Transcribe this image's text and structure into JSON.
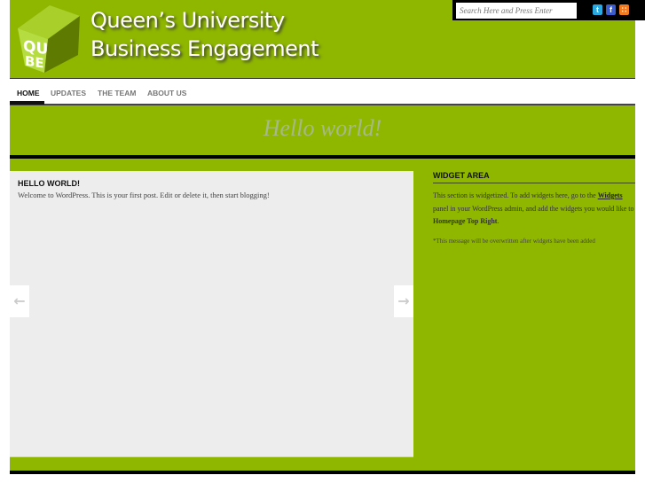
{
  "header": {
    "title_line1": "Queen’s University",
    "title_line2": "Business Engagement",
    "logo_text": "QUBE",
    "search_placeholder": "Search Here and Press Enter",
    "social": [
      {
        "name": "twitter",
        "glyph": "t",
        "color": "#2aa9e0"
      },
      {
        "name": "facebook",
        "glyph": "f",
        "color": "#3b5ccc"
      },
      {
        "name": "rss",
        "glyph": "∷",
        "color": "#f47a20"
      }
    ]
  },
  "nav": {
    "items": [
      {
        "label": "HOME",
        "active": true
      },
      {
        "label": "UPDATES"
      },
      {
        "label": "THE TEAM"
      },
      {
        "label": "ABOUT US"
      }
    ]
  },
  "featured": {
    "title": "Hello world!"
  },
  "post": {
    "title": "HELLO WORLD!",
    "body": "Welcome to WordPress. This is your first post. Edit or delete it, then start blogging!"
  },
  "slider": {
    "prev": "←",
    "next": "→"
  },
  "widget": {
    "title": "WIDGET AREA",
    "text1": "This section is widgetized. To add widgets here, go to the ",
    "link": "Widgets",
    "text2": " panel in your WordPress admin, and add the widgets you would like to ",
    "bold": "Homepage Top Right",
    "text3": ".",
    "note": "*This message will be overwritten after widgets have been added"
  },
  "colors": {
    "green": "#8fb700",
    "panel": "#ededed"
  }
}
